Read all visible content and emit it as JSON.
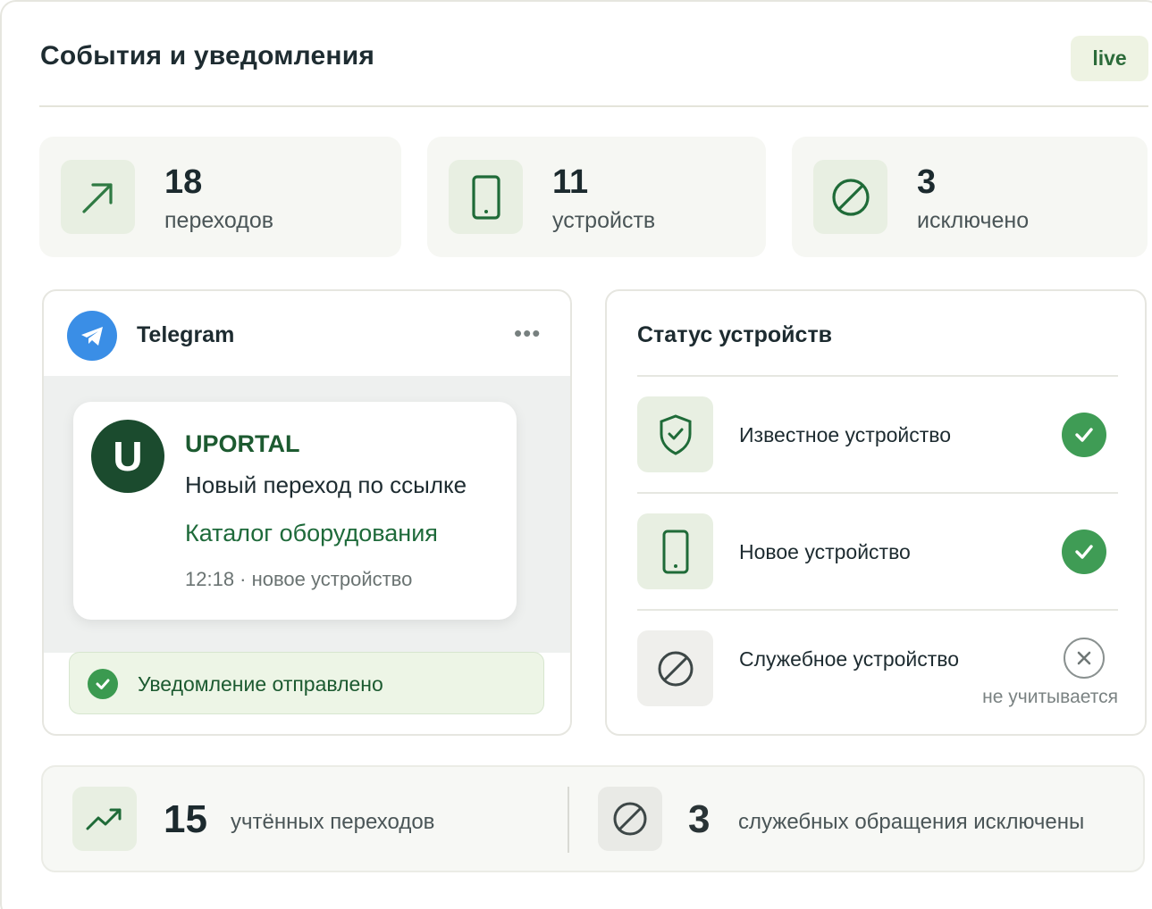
{
  "header": {
    "title": "События и уведомления",
    "live_badge": "live"
  },
  "stats": [
    {
      "value": "18",
      "label": "переходов",
      "icon": "arrow-up-right-icon"
    },
    {
      "value": "11",
      "label": "устройств",
      "icon": "phone-icon"
    },
    {
      "value": "3",
      "label": "исключено",
      "icon": "blocked-icon"
    }
  ],
  "telegram": {
    "title": "Telegram",
    "menu": "•••",
    "message": {
      "avatar_letter": "U",
      "sender": "UPORTAL",
      "text": "Новый переход по ссылке",
      "link": "Каталог оборудования",
      "meta": "12:18  ·  новое устройство"
    },
    "status_text": "Уведомление отправлено"
  },
  "device_status": {
    "title": "Статус устройств",
    "items": [
      {
        "label": "Известное устройство",
        "icon": "shield-check-icon",
        "state": "ok"
      },
      {
        "label": "Новое устройство",
        "icon": "phone-icon",
        "state": "ok"
      },
      {
        "label": "Служебное устройство",
        "icon": "blocked-icon",
        "state": "excluded",
        "note": "не учитывается"
      }
    ]
  },
  "summary": {
    "counted": {
      "value": "15",
      "label": "учтённых переходов",
      "icon": "trending-up-icon"
    },
    "excluded": {
      "value": "3",
      "label": "служебных обращения исключены",
      "icon": "blocked-icon"
    }
  },
  "colors": {
    "accent_green": "#3f9c55",
    "dark_green": "#1b4b2e",
    "telegram_blue": "#3a8ee6",
    "badge_bg": "#eef3e3"
  }
}
